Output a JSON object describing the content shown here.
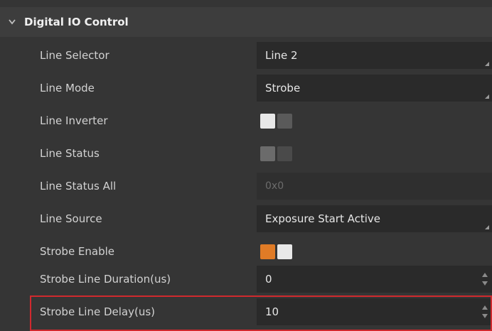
{
  "section": {
    "title": "Digital IO Control",
    "icon": "chevron-down-icon"
  },
  "rows": [
    {
      "label": "Line Selector",
      "type": "dropdown",
      "value": "Line 2"
    },
    {
      "label": "Line Mode",
      "type": "dropdown",
      "value": "Strobe"
    },
    {
      "label": "Line Inverter",
      "type": "toggle",
      "state": "off"
    },
    {
      "label": "Line Status",
      "type": "toggle",
      "state": "off",
      "disabled": true
    },
    {
      "label": "Line Status All",
      "type": "readonly",
      "value": "0x0"
    },
    {
      "label": "Line Source",
      "type": "dropdown",
      "value": "Exposure Start Active"
    },
    {
      "label": "Strobe Enable",
      "type": "toggle",
      "state": "on"
    },
    {
      "label": "Strobe Line Duration(us)",
      "type": "spinbox",
      "value": "0"
    },
    {
      "label": "Strobe Line Delay(us)",
      "type": "spinbox",
      "value": "10",
      "highlighted": true
    }
  ],
  "colors": {
    "background": "#353535",
    "header": "#3d3d3d",
    "field": "#2a2a2a",
    "toggle_on": "#e07b26",
    "highlight": "#d0292e"
  }
}
